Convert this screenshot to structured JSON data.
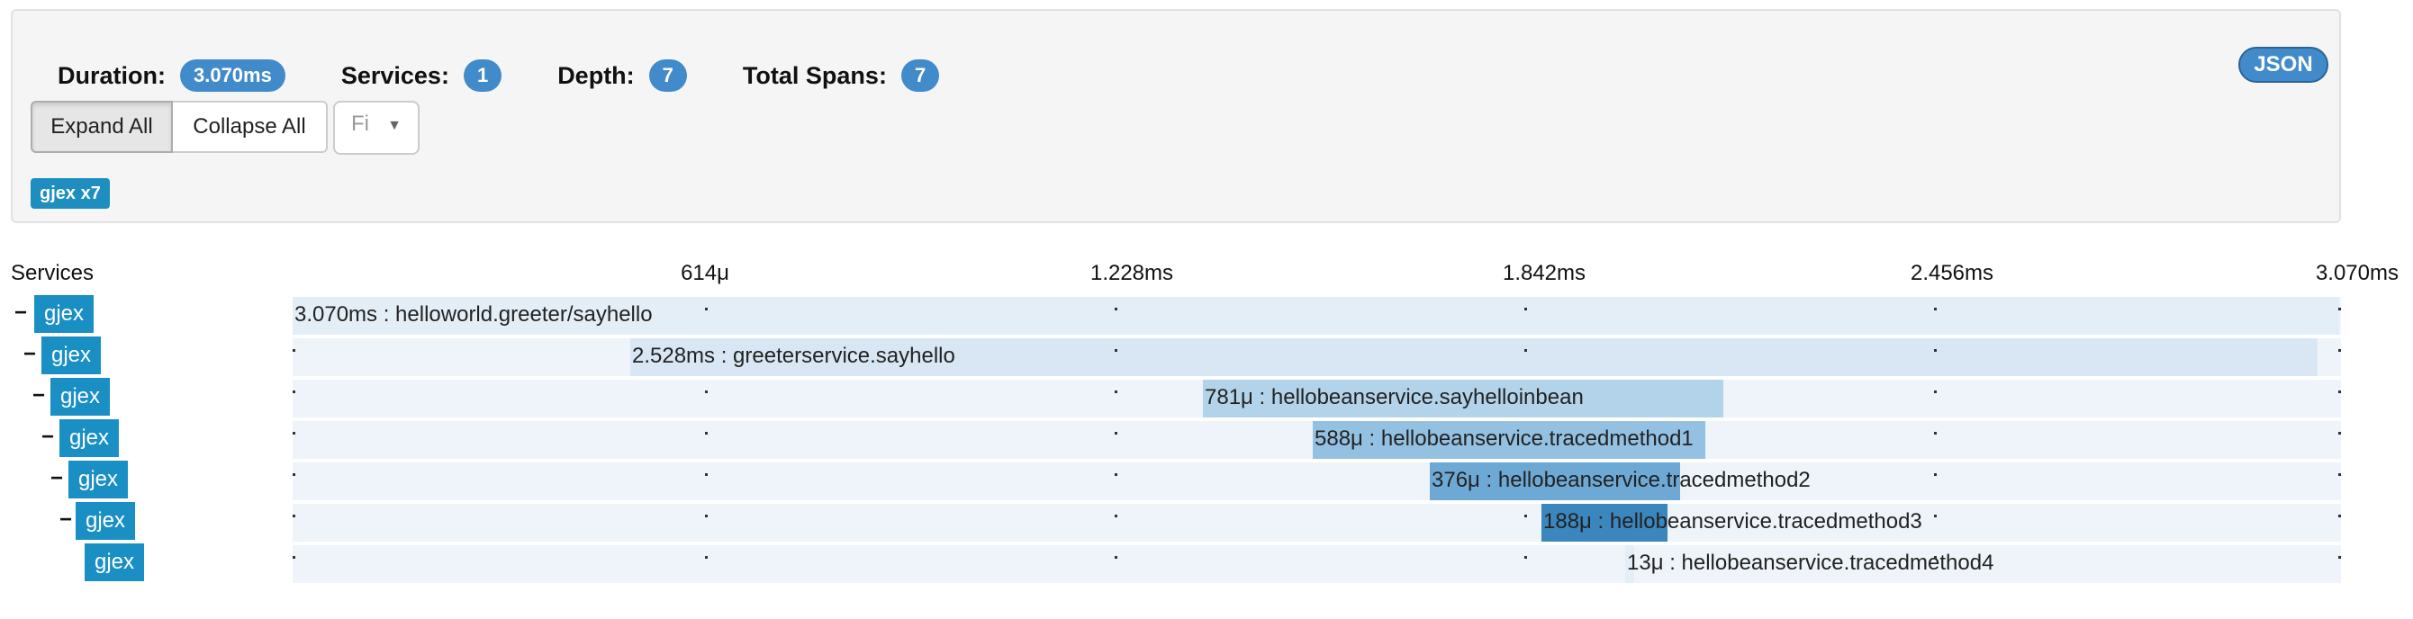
{
  "summary": {
    "duration_label": "Duration:",
    "duration": "3.070ms",
    "services_label": "Services:",
    "services": "1",
    "depth_label": "Depth:",
    "depth": "7",
    "total_spans_label": "Total Spans:",
    "total_spans": "7"
  },
  "json_button": "JSON",
  "controls": {
    "expand_all": "Expand All",
    "collapse_all": "Collapse All",
    "filter_value": "Fi"
  },
  "service_tag": "gjex x7",
  "timeline": {
    "services_header": "Services",
    "ticks": [
      "614μ",
      "1.228ms",
      "1.842ms",
      "2.456ms",
      "3.070ms"
    ]
  },
  "spans": [
    {
      "service": "gjex",
      "label": "3.070ms : helloworld.greeter/sayhello",
      "toggle": "−"
    },
    {
      "service": "gjex",
      "label": "2.528ms : greeterservice.sayhello",
      "toggle": "−"
    },
    {
      "service": "gjex",
      "label": "781μ : hellobeanservice.sayhelloinbean",
      "toggle": "−"
    },
    {
      "service": "gjex",
      "label": "588μ : hellobeanservice.tracedmethod1",
      "toggle": "−"
    },
    {
      "service": "gjex",
      "label": "376μ : hellobeanservice.tracedmethod2",
      "toggle": "−"
    },
    {
      "service": "gjex",
      "label": "188μ : hellobeanservice.tracedmethod3",
      "toggle": "−"
    },
    {
      "service": "gjex",
      "label": "13μ : hellobeanservice.tracedmethod4",
      "toggle": ""
    }
  ],
  "colors": {
    "badge": "#428bca",
    "service": "#1a8fc4",
    "bar_light": "#d8e7f3",
    "bar_mid": "#b3d3ea",
    "bar_dark": "#5b9fd0",
    "bar_darker": "#3a86bd"
  }
}
